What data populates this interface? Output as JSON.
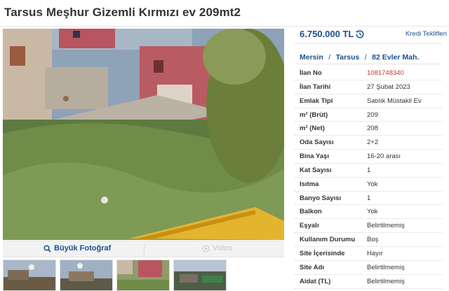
{
  "listing": {
    "title": "Tarsus Meşhur Gizemli Kırmızı ev 209mt2",
    "price": "6.750.000 TL",
    "credit_link": "Kredi Teklifleri",
    "location": {
      "city": "Mersin",
      "district": "Tarsus",
      "neighborhood": "82 Evler Mah.",
      "separator": "/"
    }
  },
  "gallery": {
    "big_photo_label": "Büyük Fotoğraf",
    "video_label": "Video",
    "thumbnail_count": 4
  },
  "details": [
    {
      "key": "İlan No",
      "value": "1081748340",
      "highlight": true
    },
    {
      "key": "İlan Tarihi",
      "value": "27 Şubat 2023"
    },
    {
      "key": "Emlak Tipi",
      "value": "Satılık Müstakil Ev"
    },
    {
      "key": "m² (Brüt)",
      "value": "209"
    },
    {
      "key": "m² (Net)",
      "value": "208"
    },
    {
      "key": "Oda Sayısı",
      "value": "2+2"
    },
    {
      "key": "Bina Yaşı",
      "value": "16-20 arası"
    },
    {
      "key": "Kat Sayısı",
      "value": "1"
    },
    {
      "key": "Isıtma",
      "value": "Yok"
    },
    {
      "key": "Banyo Sayısı",
      "value": "1"
    },
    {
      "key": "Balkon",
      "value": "Yok"
    },
    {
      "key": "Eşyalı",
      "value": "Belirtilmemiş"
    },
    {
      "key": "Kullanım Durumu",
      "value": "Boş"
    },
    {
      "key": "Site İçerisinde",
      "value": "Hayır"
    },
    {
      "key": "Site Adı",
      "value": "Belirtilmemiş"
    },
    {
      "key": "Aidat (TL)",
      "value": "Belirtilmemiş"
    }
  ],
  "colors": {
    "link_blue": "#1d4f91",
    "highlight_red": "#c0392b"
  },
  "icons": {
    "search": "magnifier-icon",
    "video": "play-circle-icon",
    "compare": "history-arrow-icon"
  }
}
